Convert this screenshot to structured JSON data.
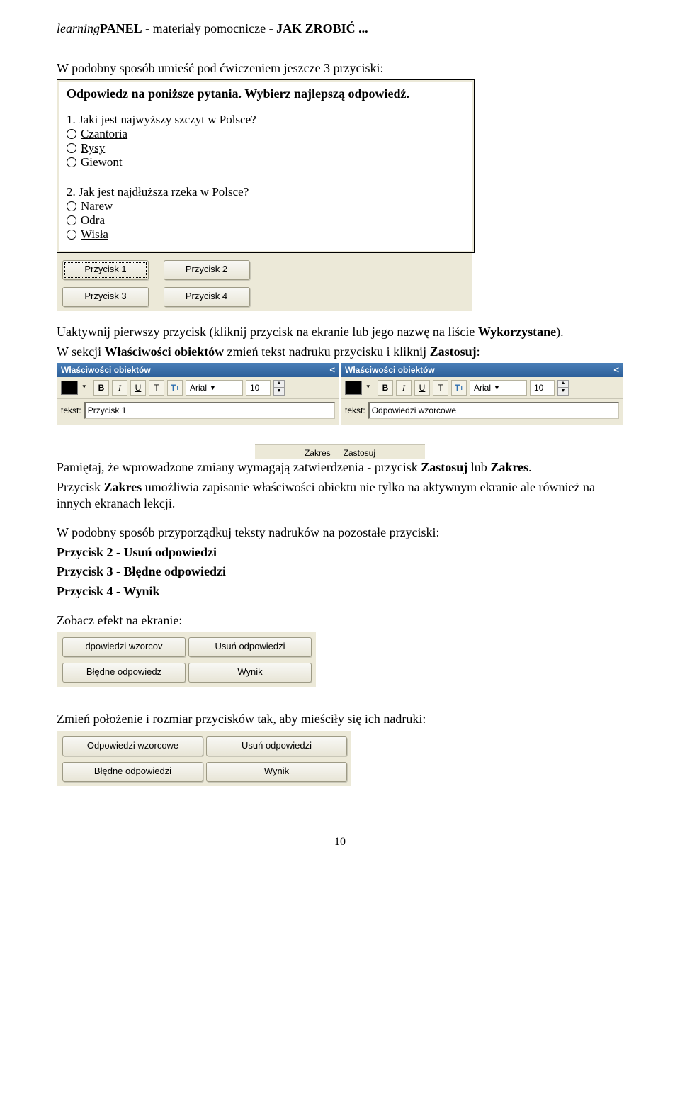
{
  "header": {
    "italic": "learning",
    "boldA": "PANEL",
    "mid": " - materiały pomocnicze - ",
    "boldB": "JAK ZROBIĆ ..."
  },
  "intro1": "W podobny sposób umieść pod ćwiczeniem jeszcze 3 przyciski:",
  "panel": {
    "title": "Odpowiedz na poniższe pytania. Wybierz najlepszą odpowiedź.",
    "q1": "1. Jaki jest najwyższy szczyt w Polsce?",
    "q1opts": [
      "Czantoria",
      "Rysy",
      "Giewont"
    ],
    "q2": "2. Jak jest najdłuższa rzeka w Polsce?",
    "q2opts": [
      "Narew",
      "Odra",
      "Wisła"
    ],
    "buttons": [
      "Przycisk 1",
      "Przycisk 2",
      "Przycisk 3",
      "Przycisk 4"
    ]
  },
  "para2a": "Uaktywnij pierwszy przycisk (kliknij przycisk na ekranie lub jego nazwę na liście ",
  "para2b_bold": "Wykorzystane",
  "para2c": ").",
  "para3a": "W sekcji ",
  "para3b_bold": "Właściwości obiektów",
  "para3c": " zmień tekst nadruku przycisku i kliknij ",
  "para3d_bold": "Zastosuj",
  "para3e": ":",
  "props": {
    "title": "Właściwości obiektów",
    "arrow": "<",
    "font": "Arial",
    "size": "10",
    "label": "tekst:",
    "val_left": "Przycisk 1",
    "val_right": "Odpowiedzi wzorcowe"
  },
  "zz": {
    "zakres": "Zakres",
    "zastosuj": "Zastosuj"
  },
  "para4a": "Pamiętaj, że wprowadzone zmiany wymagają zatwierdzenia - przycisk ",
  "para4b": "Zastosuj",
  "para4c": " lub ",
  "para4d": "Zakres",
  "para4e": ".",
  "para5a": "Przycisk ",
  "para5b": "Zakres",
  "para5c": " umożliwia zapisanie właściwości obiektu nie tylko na aktywnym ekranie ale również na innych ekranach lekcji.",
  "para6": "W podobny sposób przyporządkuj teksty nadruków na pozostałe przyciski:",
  "map2": "Przycisk 2 - Usuń odpowiedzi",
  "map3": "Przycisk 3 - Błędne odpowiedzi",
  "map4": "Przycisk 4 - Wynik",
  "see": "Zobacz efekt na ekranie:",
  "eff1": [
    "dpowiedzi wzorcov",
    "Usuń odpowiedzi",
    "Błędne odpowiedz",
    "Wynik"
  ],
  "resize": "Zmień położenie i rozmiar przycisków tak, aby mieściły się ich nadruki:",
  "eff2": [
    "Odpowiedzi wzorcowe",
    "Usuń odpowiedzi",
    "Błędne odpowiedzi",
    "Wynik"
  ],
  "page": "10"
}
